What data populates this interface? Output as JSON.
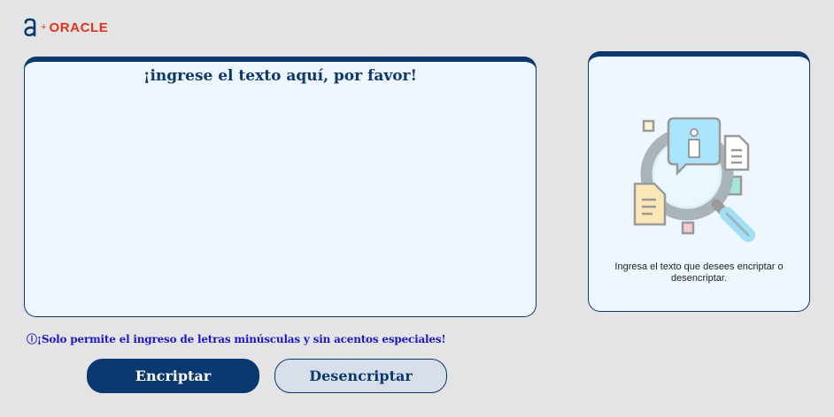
{
  "header": {
    "logo_letter_icon": "alura-a-logo",
    "logo_plus": "+",
    "logo_text": "ORACLE"
  },
  "input": {
    "placeholder": "¡ingrese el texto aquí, por favor!",
    "value": ""
  },
  "result_panel": {
    "illustration_icon": "magnifier-documents-illustration",
    "message": "Ingresa el texto que desees encriptar o desencriptar."
  },
  "notice": {
    "icon": "info-circle-icon",
    "text": "ⓘ¡Solo permite el ingreso de letras minúsculas y sin acentos especiales!"
  },
  "buttons": {
    "encrypt_label": "Encriptar",
    "decrypt_label": "Desencriptar"
  },
  "colors": {
    "primary": "#0a3871",
    "background": "#e4e4e4",
    "surface": "#eef6ff",
    "brand_oracle": "#e2331b",
    "notice": "#1a1acc"
  }
}
